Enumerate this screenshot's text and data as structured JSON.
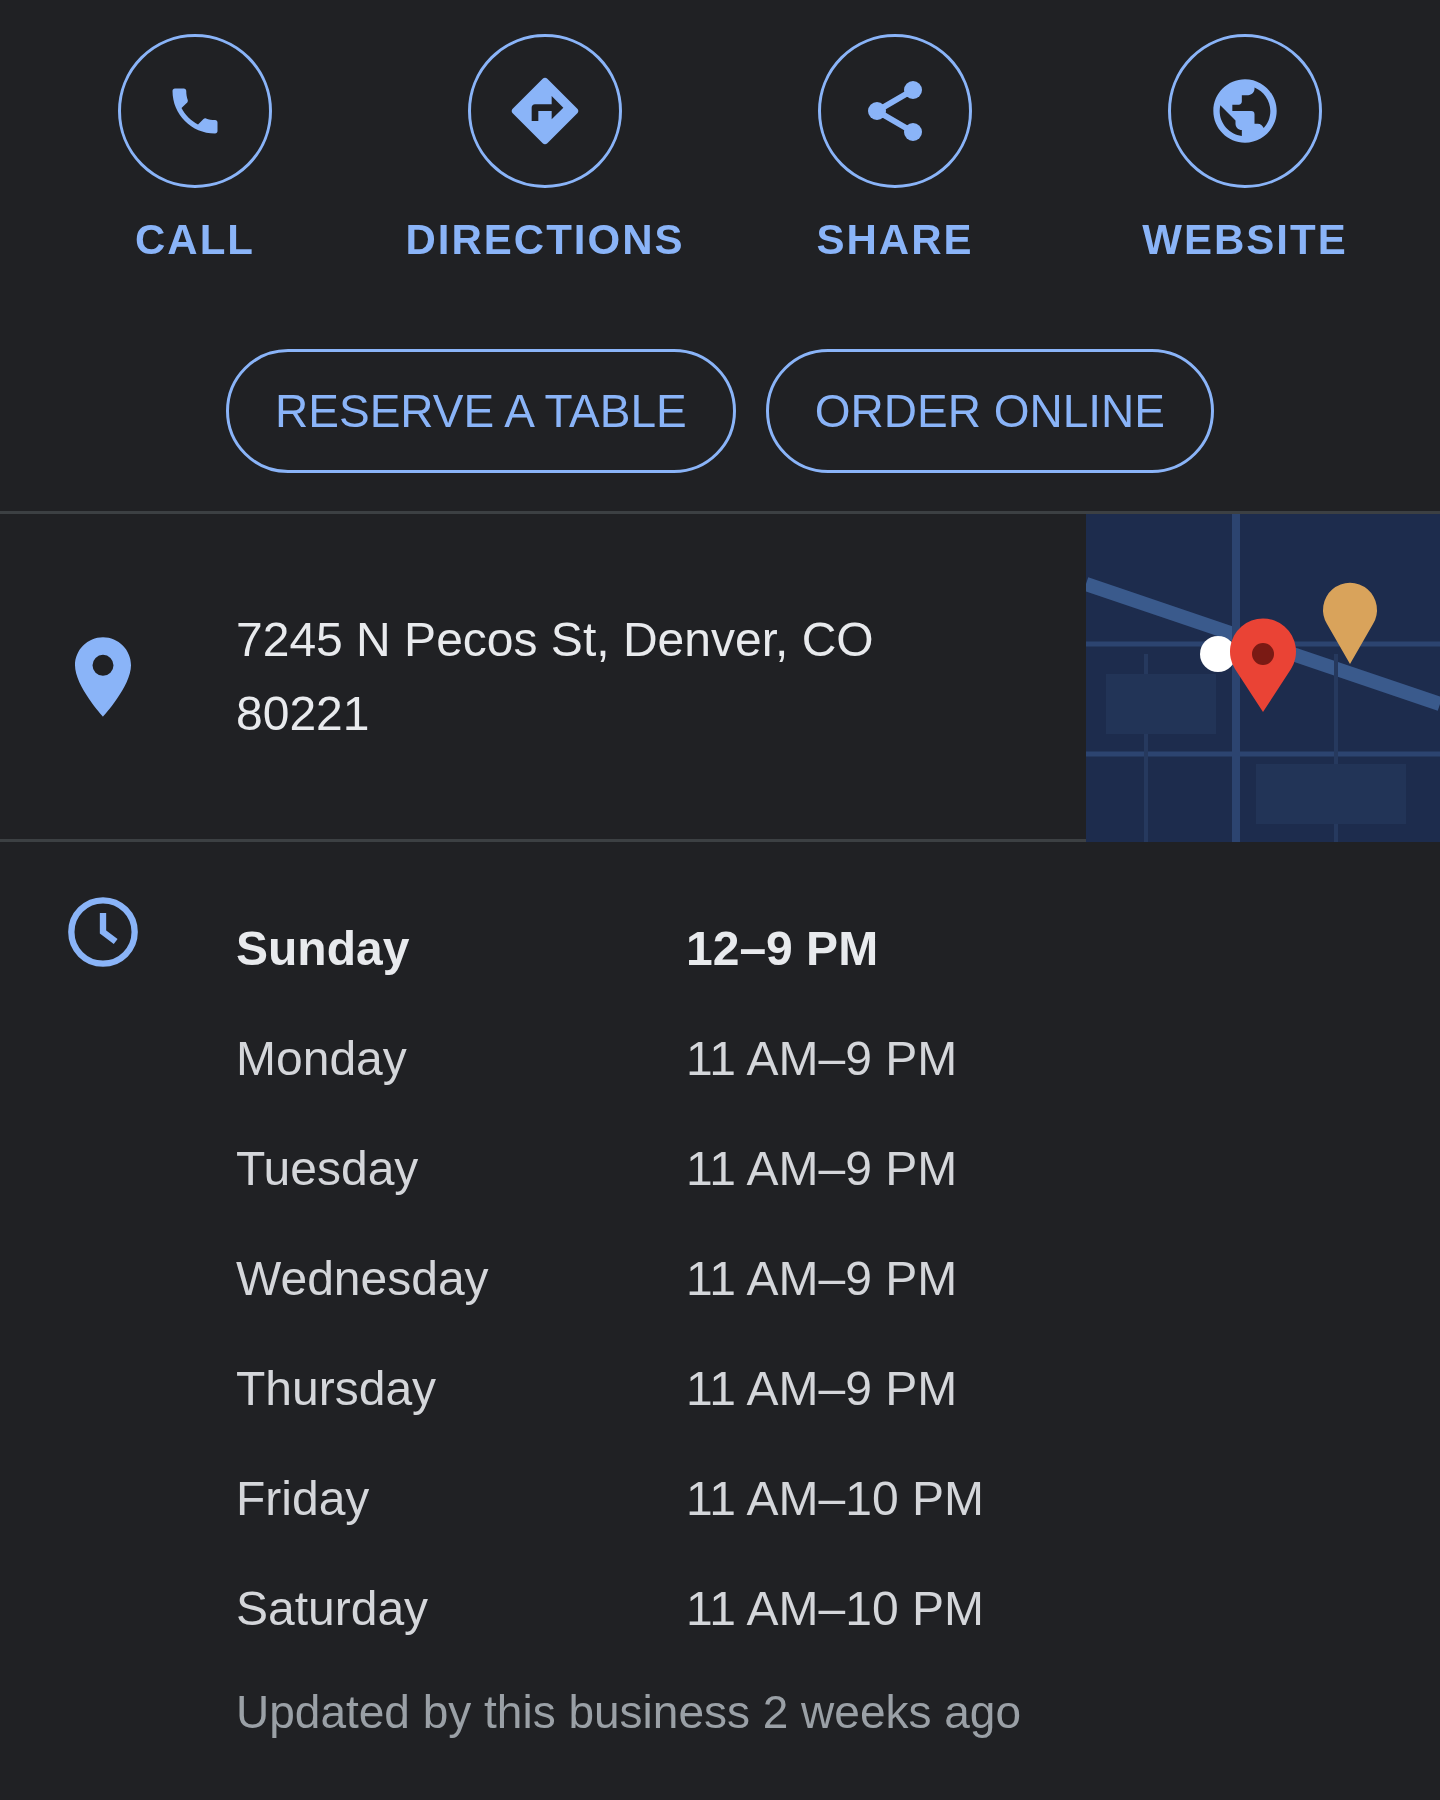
{
  "actions": [
    {
      "label": "CALL",
      "kind": "phone"
    },
    {
      "label": "DIRECTIONS",
      "kind": "directions"
    },
    {
      "label": "SHARE",
      "kind": "share"
    },
    {
      "label": "WEBSITE",
      "kind": "website"
    }
  ],
  "buttons": [
    "RESERVE A TABLE",
    "ORDER ONLINE"
  ],
  "address": {
    "text": "7245 N Pecos St, Denver, CO 80221"
  },
  "hours": [
    {
      "day": "Sunday",
      "time": "12–9 PM",
      "today": true
    },
    {
      "day": "Monday",
      "time": "11 AM–9 PM",
      "today": false
    },
    {
      "day": "Tuesday",
      "time": "11 AM–9 PM",
      "today": false
    },
    {
      "day": "Wednesday",
      "time": "11 AM–9 PM",
      "today": false
    },
    {
      "day": "Thursday",
      "time": "11 AM–9 PM",
      "today": false
    },
    {
      "day": "Friday",
      "time": "11 AM–10 PM",
      "today": false
    },
    {
      "day": "Saturday",
      "time": "11 AM–10 PM",
      "today": false
    }
  ],
  "updated": "Updated by this business 2 weeks ago"
}
